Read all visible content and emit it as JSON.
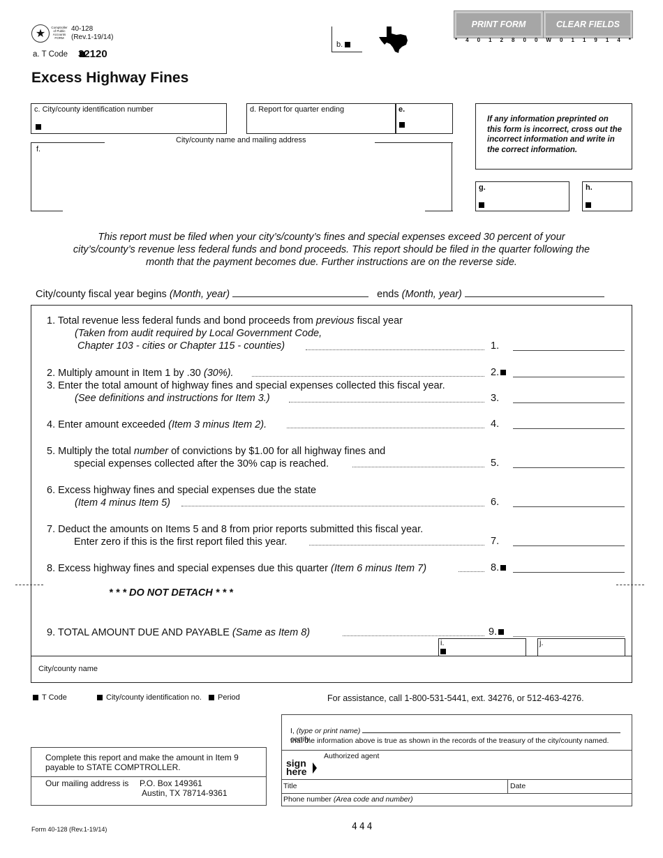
{
  "header": {
    "seal_text": [
      "Comptroller",
      "of Public",
      "Accounts",
      "FORM"
    ],
    "form_number": "40-128",
    "revision": "(Rev.1-19/14)",
    "tcode_label": "a. T Code",
    "tcode_value": "32120",
    "title": "Excess Highway Fines",
    "b_label": "b.",
    "buttons": {
      "print": "PRINT FORM",
      "clear": "CLEAR FIELDS"
    },
    "barcode_chars": [
      "*",
      "4",
      "0",
      "1",
      "2",
      "8",
      "0",
      "0",
      "W",
      "0",
      "1",
      "1",
      "9",
      "1",
      "4",
      "*"
    ],
    "button_color": "#a6a6a6"
  },
  "fields": {
    "c_label": "c. City/county identification number",
    "d_label": "d. Report for quarter ending",
    "e_label": "e.",
    "address_caption": "City/county name and mailing address",
    "f_label": "f.",
    "g_label": "g.",
    "h_label": "h.",
    "note": "If any information preprinted on this form is incorrect, cross out the incorrect information and write in the correct information."
  },
  "intro": "This report must be filed when your city’s/county’s fines and special expenses exceed 30 percent of your city’s/county’s revenue less federal funds and bond proceeds. This report should be filed in the quarter following the month that the payment becomes due. Further instructions are on the reverse side.",
  "fiscal_year": {
    "begins_label": "City/county fiscal year begins",
    "begins_hint": "(Month, year)",
    "ends_label": "ends",
    "ends_hint": "(Month, year)"
  },
  "items": [
    {
      "num": "1.",
      "line1_a": "1. Total revenue less federal funds and bond proceeds from ",
      "line1_it": "previous",
      "line1_b": " fiscal year",
      "line2": "(Taken from audit required by Local Government Code,",
      "line3": "Chapter 103 - cities or Chapter 115 - counties)"
    },
    {
      "num": "2.",
      "text": "2. Multiply amount in Item 1 by .30 ",
      "hint": "(30%)."
    },
    {
      "num": "3.",
      "line1": "3. Enter the total amount of highway fines and special expenses collected this fiscal year.",
      "line2": "(See definitions and instructions for Item 3.)"
    },
    {
      "num": "4.",
      "text": "4. Enter amount exceeded ",
      "hint": "(Item 3 minus Item 2)."
    },
    {
      "num": "5.",
      "line1_a": "5. Multiply the total ",
      "line1_it": "number",
      "line1_b": " of convictions by $1.00 for all highway fines and",
      "line2": "special expenses collected after the 30% cap is reached."
    },
    {
      "num": "6.",
      "line1": "6. Excess highway fines and special expenses due the state",
      "line2": "(Item 4 minus Item 5)"
    },
    {
      "num": "7.",
      "line1": "7. Deduct the amounts on Items 5 and 8 from prior reports submitted this fiscal year.",
      "line2": "Enter zero if this is the first report filed this year."
    },
    {
      "num": "8.",
      "text": "8. Excess highway fines and special expenses due this quarter ",
      "hint": "(Item 6 minus Item 7)"
    },
    {
      "num": "9.",
      "text": "9.  TOTAL AMOUNT DUE AND PAYABLE ",
      "hint": "(Same as Item 8)"
    }
  ],
  "do_not_detach": "* * * DO NOT DETACH * * *",
  "i_label": "i.",
  "j_label": "j.",
  "city_county_name_label": "City/county name",
  "legend": {
    "tcode": "T Code",
    "id": "City/county identification no.",
    "period": "Period"
  },
  "assistance": "For assistance, call 1-800-531-5441, ext. 34276, or 512-463-4276.",
  "certification": {
    "i_label": "I,",
    "name_hint": "(type or print name)",
    "certify": "certify",
    "statement": "that the information above is true as shown in the records of the treasury of the city/county named.",
    "agent": "Authorized agent",
    "sign": "sign",
    "here": "here",
    "title": "Title",
    "date": "Date",
    "phone": "Phone number",
    "phone_hint": "(Area code and number)"
  },
  "payment": {
    "line1": "Complete this report and make the amount in Item 9",
    "line2": "payable to STATE COMPTROLLER.",
    "address_label": "Our mailing address is",
    "address1": "P.O. Box 149361",
    "address2": "Austin, TX  78714-9361"
  },
  "footer": {
    "form": "Form 40-128 (Rev.1-19/14)",
    "page_code": "444"
  }
}
